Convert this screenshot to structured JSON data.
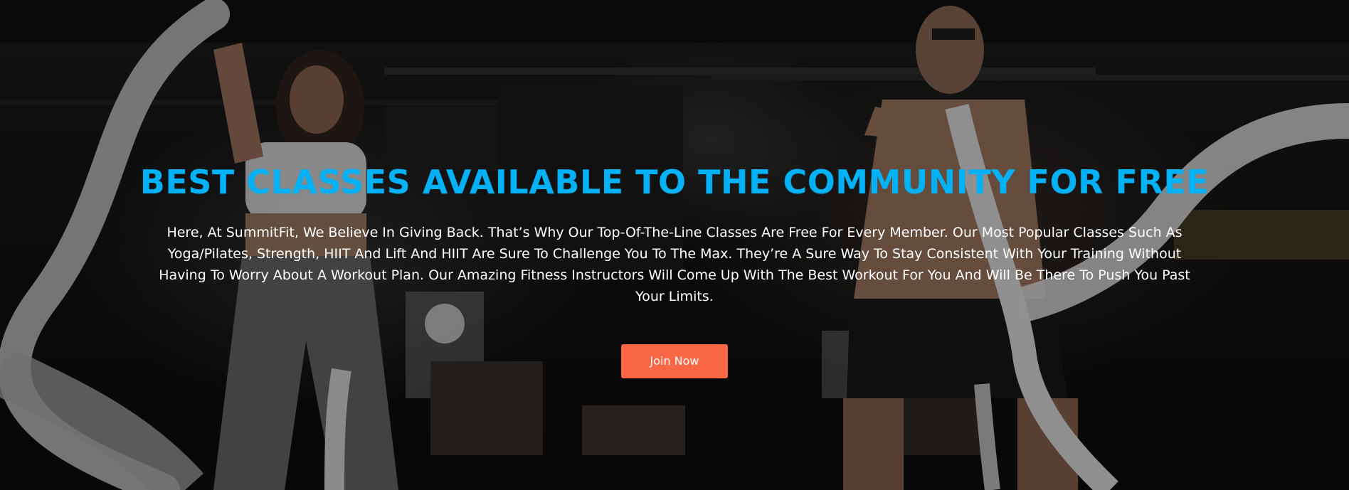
{
  "hero": {
    "headline": "BEST CLASSES AVAILABLE TO THE COMMUNITY FOR FREE",
    "body": "Here, At SummitFit, We Believe In Giving Back. That’s Why Our Top-Of-The-Line Classes Are Free For Every Member. Our Most Popular Classes Such As Yoga/Pilates, Strength, HIIT And Lift And HIIT Are Sure To Challenge You To The Max. They’re A Sure Way To Stay Consistent With Your Training Without Having To Worry About A Workout Plan. Our Amazing Fitness Instructors Will Come Up With The Best Workout For You And Will Be There To Push You Past Your Limits.",
    "cta_label": "Join Now",
    "colors": {
      "headline": "#00b2f5",
      "cta_background": "#fb6745",
      "text": "#ffffff"
    }
  }
}
